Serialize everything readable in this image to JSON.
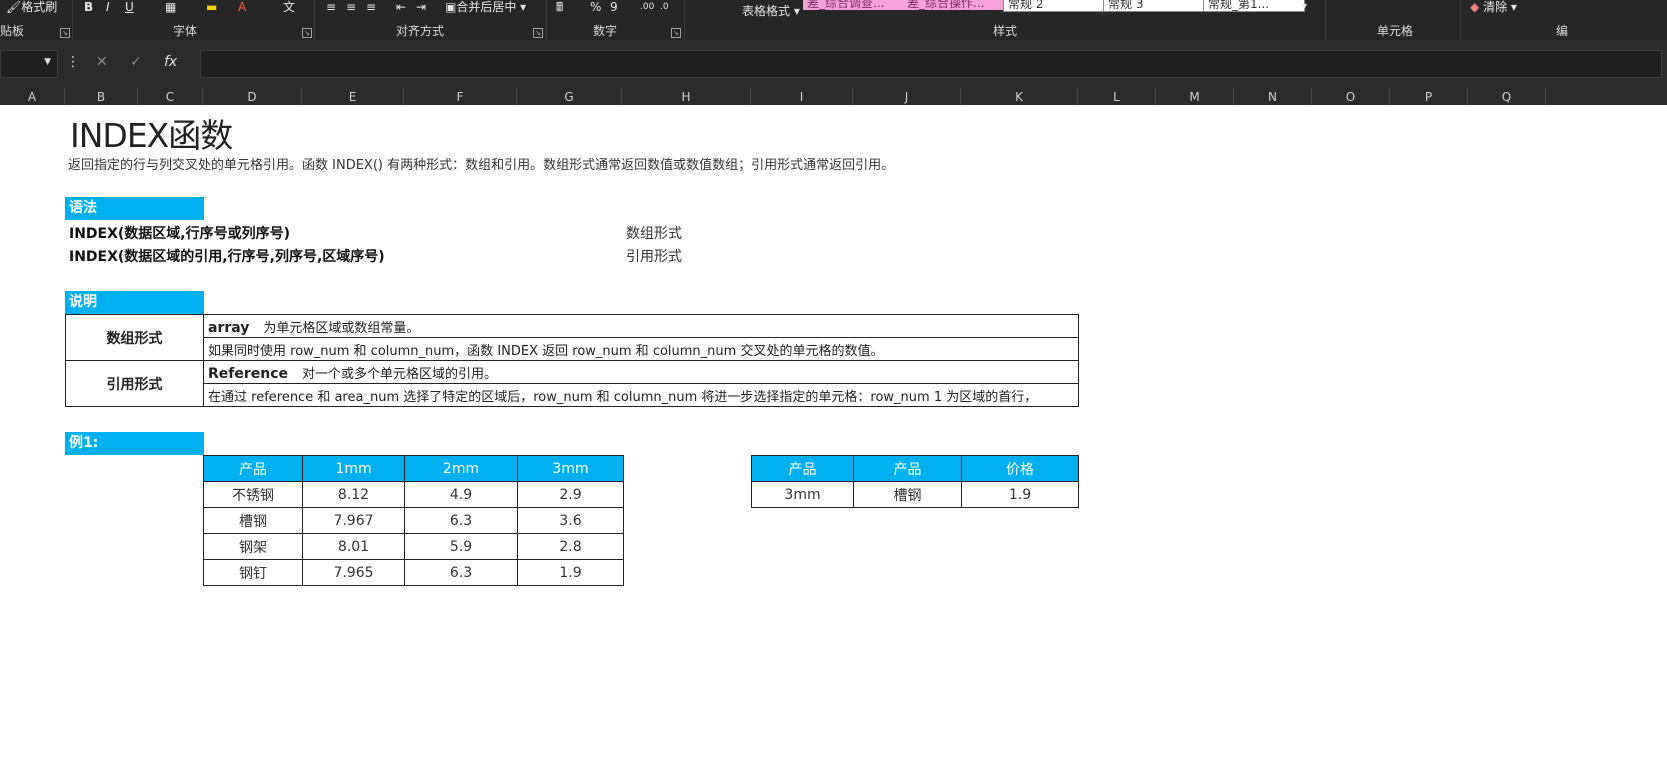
{
  "ribbon": {
    "clipboard": {
      "label": "贴板",
      "format_painter": "格式刷"
    },
    "font": {
      "label": "字体",
      "bold": "B",
      "italic": "I",
      "underline": "U"
    },
    "alignment": {
      "label": "对齐方式",
      "merge_center": "合并后居中"
    },
    "number": {
      "label": "数字",
      "percent": "%",
      "comma": "9"
    },
    "styles": {
      "label": "样式",
      "table_format": "表格格式",
      "boxes": [
        "差_综合调查...",
        "差_综合操作...",
        "常规 2",
        "常规 3",
        "常规_第1..."
      ]
    },
    "cells": {
      "label": "单元格"
    },
    "editing": {
      "clear": "清除",
      "edit_label": "编"
    }
  },
  "formula_bar": {
    "name_box": "",
    "cancel": "✕",
    "enter": "✓",
    "fx": "fx",
    "formula": ""
  },
  "columns": [
    "A",
    "B",
    "C",
    "D",
    "E",
    "F",
    "G",
    "H",
    "I",
    "J",
    "K",
    "L",
    "M",
    "N",
    "O",
    "P",
    "Q"
  ],
  "sheet": {
    "title": "INDEX函数",
    "description": "返回指定的行与列交叉处的单元格引用。函数 INDEX() 有两种形式：数组和引用。数组形式通常返回数值或数值数组；引用形式通常返回引用。",
    "syntax": {
      "header": "语法",
      "rows": [
        {
          "formula": "INDEX(数据区域,行序号或列序号)",
          "form": "数组形式"
        },
        {
          "formula": "INDEX(数据区域的引用,行序号,列序号,区域序号)",
          "form": "引用形式"
        }
      ]
    },
    "explanation": {
      "header": "说明",
      "array_form": {
        "label": "数组形式",
        "line1_term": "array",
        "line1_text": "为单元格区域或数组常量。",
        "line2": "如果同时使用 row_num 和 column_num，函数 INDEX 返回 row_num 和 column_num 交叉处的单元格的数值。"
      },
      "ref_form": {
        "label": "引用形式",
        "line1_term": "Reference",
        "line1_text": "对一个或多个单元格区域的引用。",
        "line2": "在通过 reference 和 area_num 选择了特定的区域后，row_num 和 column_num 将进一步选择指定的单元格：row_num 1 为区域的首行，"
      }
    },
    "example1": {
      "header": "例1:",
      "table": {
        "headers": [
          "产品",
          "1mm",
          "2mm",
          "3mm"
        ],
        "rows": [
          [
            "不锈钢",
            "8.12",
            "4.9",
            "2.9"
          ],
          [
            "槽钢",
            "7.967",
            "6.3",
            "3.6"
          ],
          [
            "钢架",
            "8.01",
            "5.9",
            "2.8"
          ],
          [
            "钢钉",
            "7.965",
            "6.3",
            "1.9"
          ]
        ]
      },
      "lookup": {
        "headers": [
          "产品",
          "产品",
          "价格"
        ],
        "row": [
          "3mm",
          "槽钢",
          "1.9"
        ]
      }
    }
  },
  "colors": {
    "accent": "#00b0f0",
    "ribbon_bg": "#262626",
    "pink_style": "#f4a3d4"
  }
}
